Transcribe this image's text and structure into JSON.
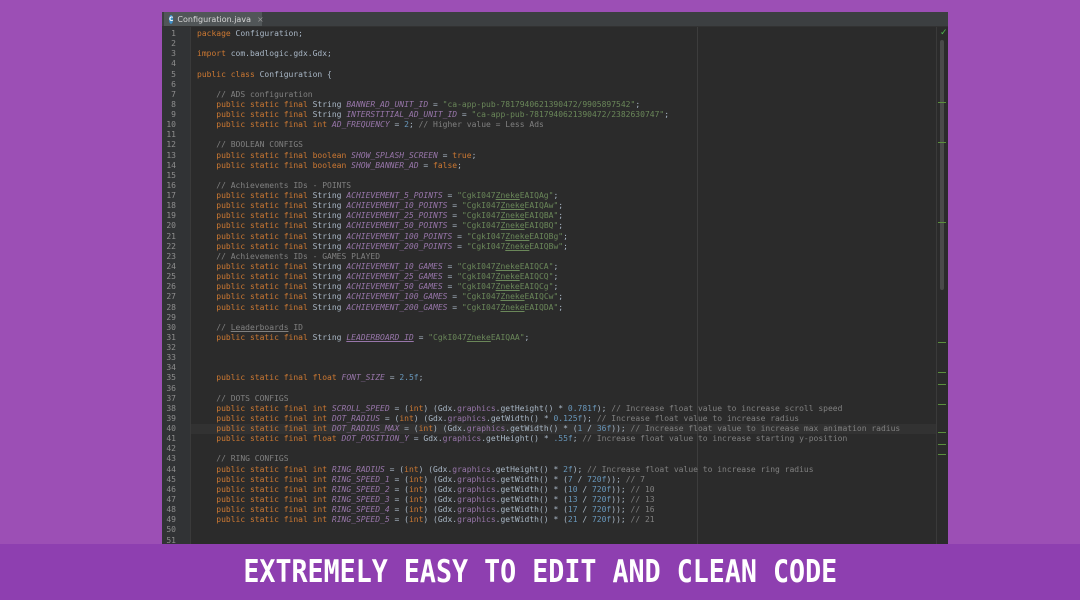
{
  "editor": {
    "tab": {
      "label": "Configuration.java",
      "icon": "class-icon",
      "icon_text": "C",
      "close": "×"
    },
    "check_icon": "✓",
    "highlighted_line": 40,
    "code_lines": [
      {
        "n": "1",
        "html": "<span class=\"kw\">package</span> Configuration;"
      },
      {
        "n": "2",
        "html": ""
      },
      {
        "n": "3",
        "html": "<span class=\"kw\">import</span> com.badlogic.gdx.Gdx;"
      },
      {
        "n": "4",
        "html": ""
      },
      {
        "n": "5",
        "html": "<span class=\"kw\">public class</span> Configuration {"
      },
      {
        "n": "6",
        "html": ""
      },
      {
        "n": "7",
        "html": "    <span class=\"cmt\">// ADS configuration</span>"
      },
      {
        "n": "8",
        "html": "    <span class=\"kw\">public static final</span> String <span class=\"fld\">BANNER_AD_UNIT_ID</span> = <span class=\"str\">\"ca-app-pub-7817940621390472/9905897542\"</span>;"
      },
      {
        "n": "9",
        "html": "    <span class=\"kw\">public static final</span> String <span class=\"fld\">INTERSTITIAL_AD_UNIT_ID</span> = <span class=\"str\">\"ca-app-pub-7817940621390472/2382630747\"</span>;"
      },
      {
        "n": "10",
        "html": "    <span class=\"kw\">public static final int</span> <span class=\"fld\">AD_FREQUENCY</span> = <span class=\"num\">2</span>; <span class=\"cmt\">// Higher value = Less Ads</span>"
      },
      {
        "n": "11",
        "html": ""
      },
      {
        "n": "12",
        "html": "    <span class=\"cmt\">// BOOLEAN CONFIGS</span>"
      },
      {
        "n": "13",
        "html": "    <span class=\"kw\">public static final boolean</span> <span class=\"fld\">SHOW_SPLASH_SCREEN</span> = <span class=\"kw\">true</span>;"
      },
      {
        "n": "14",
        "html": "    <span class=\"kw\">public static final boolean</span> <span class=\"fld\">SHOW_BANNER_AD</span> = <span class=\"kw\">false</span>;"
      },
      {
        "n": "15",
        "html": ""
      },
      {
        "n": "16",
        "html": "    <span class=\"cmt\">// Achievements IDs - POINTS</span>"
      },
      {
        "n": "17",
        "html": "    <span class=\"kw\">public static final</span> String <span class=\"fld\">ACHIEVEMENT_5_POINTS</span> = <span class=\"str\">\"CgkI047<span class=\"ul\">Zneke</span>EAIQAg\"</span>;"
      },
      {
        "n": "18",
        "html": "    <span class=\"kw\">public static final</span> String <span class=\"fld\">ACHIEVEMENT_10_POINTS</span> = <span class=\"str\">\"CgkI047<span class=\"ul\">Zneke</span>EAIQAw\"</span>;"
      },
      {
        "n": "19",
        "html": "    <span class=\"kw\">public static final</span> String <span class=\"fld\">ACHIEVEMENT_25_POINTS</span> = <span class=\"str\">\"CgkI047<span class=\"ul\">Zneke</span>EAIQBA\"</span>;"
      },
      {
        "n": "20",
        "html": "    <span class=\"kw\">public static final</span> String <span class=\"fld\">ACHIEVEMENT_50_POINTS</span> = <span class=\"str\">\"CgkI047<span class=\"ul\">Zneke</span>EAIQBQ\"</span>;"
      },
      {
        "n": "21",
        "html": "    <span class=\"kw\">public static final</span> String <span class=\"fld\">ACHIEVEMENT_100_POINTS</span> = <span class=\"str\">\"CgkI047<span class=\"ul\">Zneke</span>EAIQBg\"</span>;"
      },
      {
        "n": "22",
        "html": "    <span class=\"kw\">public static final</span> String <span class=\"fld\">ACHIEVEMENT_200_POINTS</span> = <span class=\"str\">\"CgkI047<span class=\"ul\">Zneke</span>EAIQBw\"</span>;"
      },
      {
        "n": "23",
        "html": "    <span class=\"cmt\">// Achievements IDs - GAMES PLAYED</span>"
      },
      {
        "n": "24",
        "html": "    <span class=\"kw\">public static final</span> String <span class=\"fld\">ACHIEVEMENT_10_GAMES</span> = <span class=\"str\">\"CgkI047<span class=\"ul\">Zneke</span>EAIQCA\"</span>;"
      },
      {
        "n": "25",
        "html": "    <span class=\"kw\">public static final</span> String <span class=\"fld\">ACHIEVEMENT_25_GAMES</span> = <span class=\"str\">\"CgkI047<span class=\"ul\">Zneke</span>EAIQCQ\"</span>;"
      },
      {
        "n": "26",
        "html": "    <span class=\"kw\">public static final</span> String <span class=\"fld\">ACHIEVEMENT_50_GAMES</span> = <span class=\"str\">\"CgkI047<span class=\"ul\">Zneke</span>EAIQCg\"</span>;"
      },
      {
        "n": "27",
        "html": "    <span class=\"kw\">public static final</span> String <span class=\"fld\">ACHIEVEMENT_100_GAMES</span> = <span class=\"str\">\"CgkI047<span class=\"ul\">Zneke</span>EAIQCw\"</span>;"
      },
      {
        "n": "28",
        "html": "    <span class=\"kw\">public static final</span> String <span class=\"fld\">ACHIEVEMENT_200_GAMES</span> = <span class=\"str\">\"CgkI047<span class=\"ul\">Zneke</span>EAIQDA\"</span>;"
      },
      {
        "n": "29",
        "html": ""
      },
      {
        "n": "30",
        "html": "    <span class=\"cmt\">// <span class=\"ul\">Leaderboards</span> ID</span>"
      },
      {
        "n": "31",
        "html": "    <span class=\"kw\">public static final</span> String <span class=\"fld ul\">LEADERBOARD_ID</span> = <span class=\"str\">\"CgkI047<span class=\"ul\">Zneke</span>EAIQAA\"</span>;"
      },
      {
        "n": "32",
        "html": ""
      },
      {
        "n": "33",
        "html": ""
      },
      {
        "n": "34",
        "html": ""
      },
      {
        "n": "35",
        "html": "    <span class=\"kw\">public static final float</span> <span class=\"fld\">FONT_SIZE</span> = <span class=\"num\">2.5f</span>;"
      },
      {
        "n": "36",
        "html": ""
      },
      {
        "n": "37",
        "html": "    <span class=\"cmt\">// DOTS CONFIGS</span>"
      },
      {
        "n": "38",
        "html": "    <span class=\"kw\">public static final int</span> <span class=\"fld\">SCROLL_SPEED</span> = (<span class=\"kw\">int</span>) (Gdx.<span class=\"sta\">graphics</span>.getHeight() * <span class=\"num\">0.781f</span>); <span class=\"cmt\">// Increase float value to increase scroll speed</span>"
      },
      {
        "n": "39",
        "html": "    <span class=\"kw\">public static final int</span> <span class=\"fld\">DOT_RADIUS</span> = (<span class=\"kw\">int</span>) (Gdx.<span class=\"sta\">graphics</span>.getWidth() * <span class=\"num\">0.125f</span>); <span class=\"cmt\">// Increase float value to increase radius</span>"
      },
      {
        "n": "40",
        "html": "    <span class=\"kw\">public static final int</span> <span class=\"fld\">DOT_RADIUS_MAX</span> = (<span class=\"kw\">int</span>) (Gdx.<span class=\"sta\">graphics</span>.getWidth() * (<span class=\"num\">1</span> / <span class=\"num\">36f</span>)); <span class=\"cmt\">// Increase float value to increase max animation radius</span>"
      },
      {
        "n": "41",
        "html": "    <span class=\"kw\">public static final float</span> <span class=\"fld\">DOT_POSITION_Y</span> = Gdx.<span class=\"sta\">graphics</span>.getHeight() * <span class=\"num\">.55f</span>; <span class=\"cmt\">// Increase float value to increase starting y-position</span>"
      },
      {
        "n": "42",
        "html": ""
      },
      {
        "n": "43",
        "html": "    <span class=\"cmt\">// RING CONFIGS</span>"
      },
      {
        "n": "44",
        "html": "    <span class=\"kw\">public static final int</span> <span class=\"fld\">RING_RADIUS</span> = (<span class=\"kw\">int</span>) (Gdx.<span class=\"sta\">graphics</span>.getHeight() * <span class=\"num\">2f</span>); <span class=\"cmt\">// Increase float value to increase ring radius</span>"
      },
      {
        "n": "45",
        "html": "    <span class=\"kw\">public static final int</span> <span class=\"fld\">RING_SPEED_1</span> = (<span class=\"kw\">int</span>) (Gdx.<span class=\"sta\">graphics</span>.getWidth() * (<span class=\"num\">7</span> / <span class=\"num\">720f</span>)); <span class=\"cmt\">// 7</span>"
      },
      {
        "n": "46",
        "html": "    <span class=\"kw\">public static final int</span> <span class=\"fld\">RING_SPEED_2</span> = (<span class=\"kw\">int</span>) (Gdx.<span class=\"sta\">graphics</span>.getWidth() * (<span class=\"num\">10</span> / <span class=\"num\">720f</span>)); <span class=\"cmt\">// 10</span>"
      },
      {
        "n": "47",
        "html": "    <span class=\"kw\">public static final int</span> <span class=\"fld\">RING_SPEED_3</span> = (<span class=\"kw\">int</span>) (Gdx.<span class=\"sta\">graphics</span>.getWidth() * (<span class=\"num\">13</span> / <span class=\"num\">720f</span>)); <span class=\"cmt\">// 13</span>"
      },
      {
        "n": "48",
        "html": "    <span class=\"kw\">public static final int</span> <span class=\"fld\">RING_SPEED_4</span> = (<span class=\"kw\">int</span>) (Gdx.<span class=\"sta\">graphics</span>.getWidth() * (<span class=\"num\">17</span> / <span class=\"num\">720f</span>)); <span class=\"cmt\">// 16</span>"
      },
      {
        "n": "49",
        "html": "    <span class=\"kw\">public static final int</span> <span class=\"fld\">RING_SPEED_5</span> = (<span class=\"kw\">int</span>) (Gdx.<span class=\"sta\">graphics</span>.getWidth() * (<span class=\"num\">21</span> / <span class=\"num\">720f</span>)); <span class=\"cmt\">// 21</span>"
      },
      {
        "n": "50",
        "html": ""
      },
      {
        "n": "51",
        "html": ""
      }
    ]
  },
  "banner": {
    "text": "EXTREMELY EASY TO EDIT AND CLEAN CODE"
  },
  "colors": {
    "background": "#9c4fb5",
    "banner": "#8e3fb0",
    "editor": "#2b2b2b"
  }
}
